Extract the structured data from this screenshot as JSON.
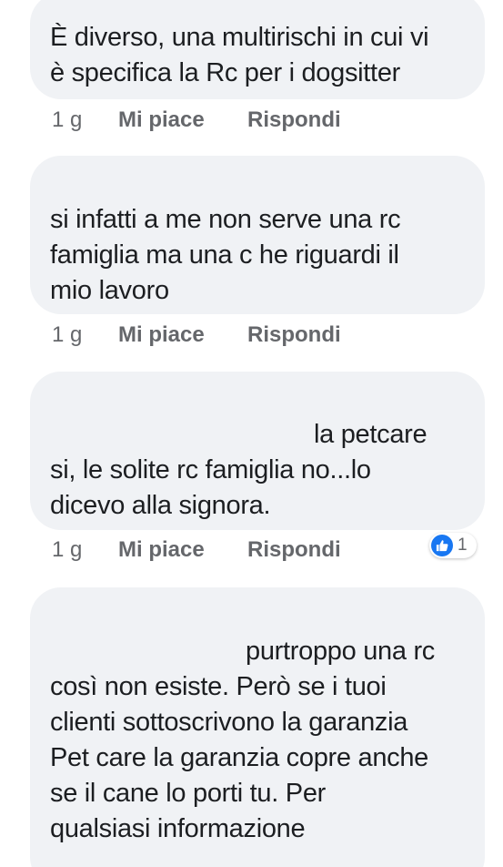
{
  "comments": [
    {
      "lines": [
        "È diverso, una multirischi in cui vi",
        "è specifica la Rc per i dogsitter"
      ],
      "time": "1 g",
      "like": "Mi piace",
      "reply": "Rispondi"
    },
    {
      "lines": [
        "si infatti a me non serve una rc",
        "famiglia ma una c he riguardi il",
        "mio lavoro"
      ],
      "time": "1 g",
      "like": "Mi piace",
      "reply": "Rispondi"
    },
    {
      "lines": [
        "la petcare",
        "si, le solite rc famiglia no...lo",
        "dicevo alla signora."
      ],
      "time": "1 g",
      "like": "Mi piace",
      "reply": "Rispondi",
      "reaction_count": "1",
      "reaction_icon": "like-icon",
      "reaction_color": "#1877f2"
    },
    {
      "lines": [
        "purtroppo una rc",
        "così non esiste. Però se i tuoi",
        "clienti sottoscrivono la garanzia",
        "Pet care la garanzia copre anche",
        "se il cane lo porti tu. Per",
        "qualsiasi informazione"
      ]
    }
  ]
}
